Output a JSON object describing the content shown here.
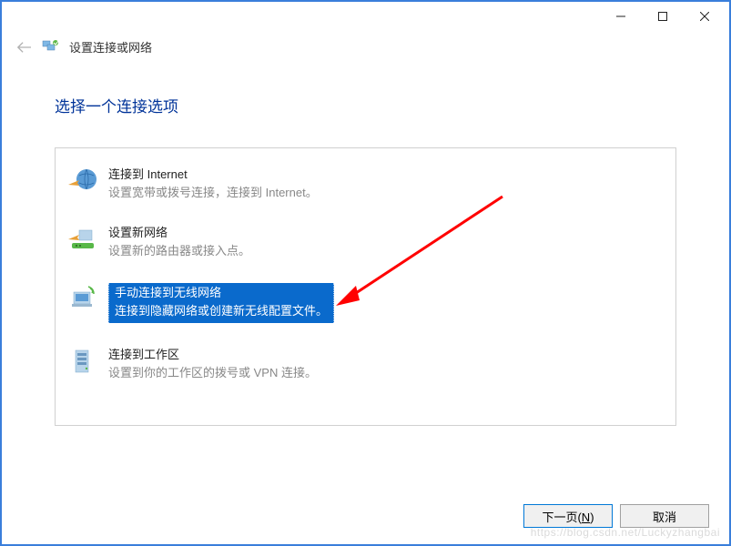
{
  "titlebar": {
    "minimize": "－",
    "maximize": "□",
    "close": "✕"
  },
  "header": {
    "title": "设置连接或网络"
  },
  "page": {
    "heading": "选择一个连接选项"
  },
  "options": [
    {
      "title": "连接到 Internet",
      "desc": "设置宽带或拨号连接，连接到 Internet。",
      "selected": false
    },
    {
      "title": "设置新网络",
      "desc": "设置新的路由器或接入点。",
      "selected": false
    },
    {
      "title": "手动连接到无线网络",
      "desc": "连接到隐藏网络或创建新无线配置文件。",
      "selected": true
    },
    {
      "title": "连接到工作区",
      "desc": "设置到你的工作区的拨号或 VPN 连接。",
      "selected": false
    }
  ],
  "footer": {
    "next": "下一页(N)",
    "cancel": "取消"
  },
  "watermark": "https://blog.csdn.net/Luckyzhangbai"
}
